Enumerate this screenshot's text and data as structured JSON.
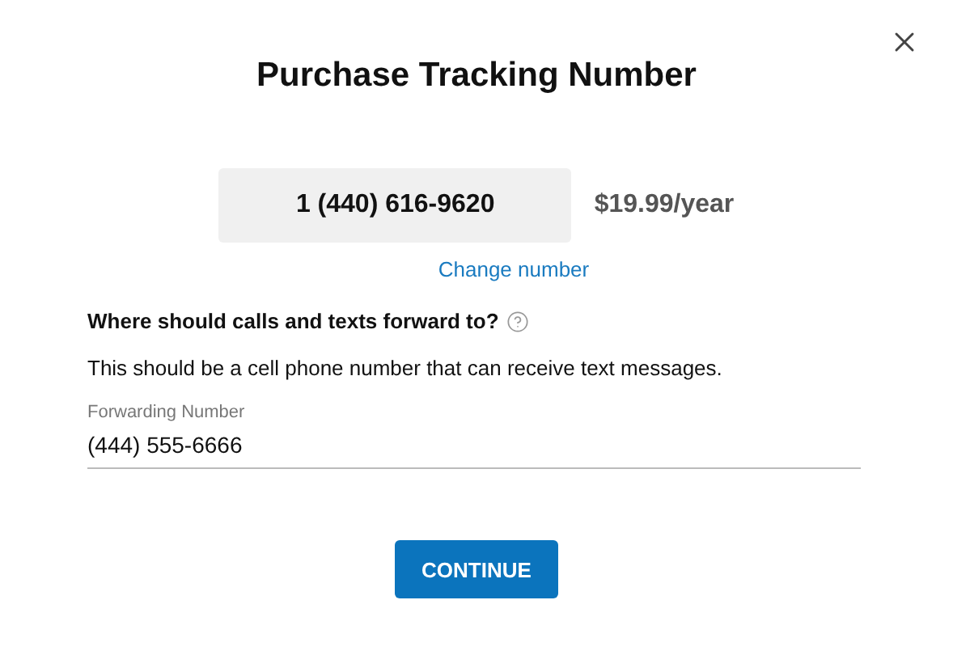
{
  "dialog": {
    "title": "Purchase Tracking Number",
    "tracking_number": "1 (440) 616-9620",
    "price": "$19.99/year",
    "change_link": "Change number",
    "question": "Where should calls and texts forward to?",
    "description": "This should be a cell phone number that can receive text messages.",
    "forwarding_field": {
      "label": "Forwarding Number",
      "value": "(444) 555-6666"
    },
    "continue_button": "CONTINUE"
  }
}
